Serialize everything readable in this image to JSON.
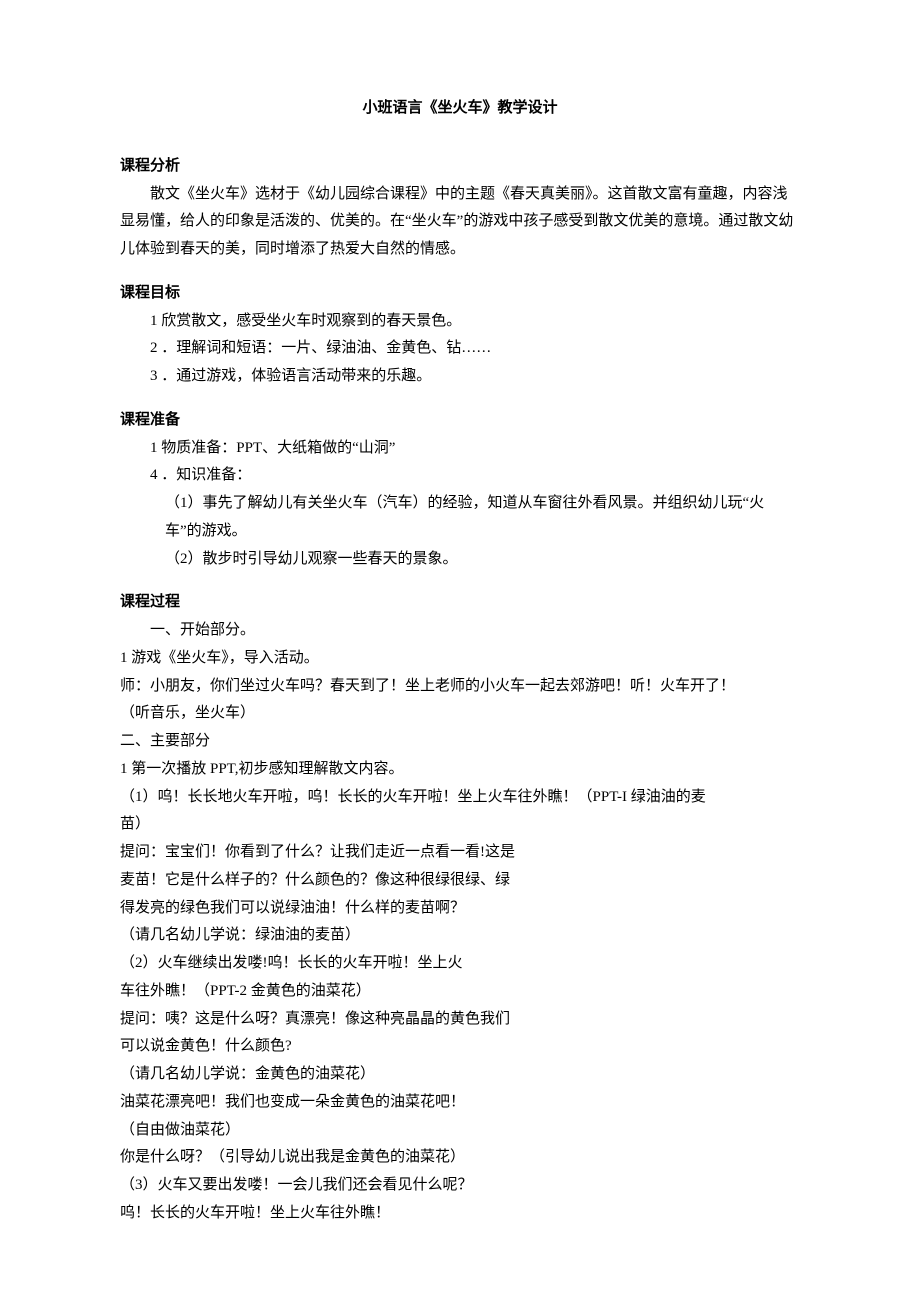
{
  "title": "小班语言《坐火车》教学设计",
  "analysis": {
    "heading": "课程分析",
    "para": "散文《坐火车》选材于《幼儿园综合课程》中的主题《春天真美丽》。这首散文富有童趣，内容浅显易懂，给人的印象是活泼的、优美的。在“坐火车”的游戏中孩子感受到散文优美的意境。通过散文幼儿体验到春天的美，同时增添了热爱大自然的情感。"
  },
  "goals": {
    "heading": "课程目标",
    "items": [
      "1 欣赏散文，感受坐火车时观察到的春天景色。",
      "2 ．理解词和短语：一片、绿油油、金黄色、钻……",
      "3 ．通过游戏，体验语言活动带来的乐趣。"
    ]
  },
  "prep": {
    "heading": "课程准备",
    "items": [
      "1 物质准备：PPT、大纸箱做的“山洞”",
      "4 ．知识准备："
    ],
    "sub": [
      "（1）事先了解幼儿有关坐火车（汽车）的经验，知道从车窗往外看风景。并组织幼儿玩“火车”的游戏。",
      "（2）散步时引导幼儿观察一些春天的景象。"
    ]
  },
  "process": {
    "heading": "课程过程",
    "intro": "一、开始部分。",
    "lines": [
      "1 游戏《坐火车》，导入活动。",
      "师：小朋友，你们坐过火车吗？春天到了！坐上老师的小火车一起去郊游吧！听！火车开了！",
      "（听音乐，坐火车）",
      "二、主要部分",
      "1 第一次播放 PPT,初步感知理解散文内容。",
      "（1）呜！长长地火车开啦，呜！长长的火车开啦！坐上火车往外瞧！（PPT-I 绿油油的麦",
      "苗）",
      "提问：宝宝们！你看到了什么？让我们走近一点看一看!这是",
      "麦苗！它是什么样子的？什么颜色的？像这种很绿很绿、绿",
      "得发亮的绿色我们可以说绿油油！什么样的麦苗啊？",
      "（请几名幼儿学说：绿油油的麦苗）",
      "（2）火车继续出发喽!呜！长长的火车开啦！坐上火",
      "车往外瞧！（PPT-2 金黄色的油菜花）",
      "提问：咦？这是什么呀？真漂亮！像这种亮晶晶的黄色我们",
      "可以说金黄色！什么颜色?",
      "（请几名幼儿学说：金黄色的油菜花）",
      "油菜花漂亮吧！我们也变成一朵金黄色的油菜花吧！",
      "（自由做油菜花）",
      "你是什么呀？（引导幼儿说出我是金黄色的油菜花）",
      "（3）火车又要出发喽！一会儿我们还会看见什么呢？",
      "呜！长长的火车开啦！坐上火车往外瞧！"
    ]
  }
}
